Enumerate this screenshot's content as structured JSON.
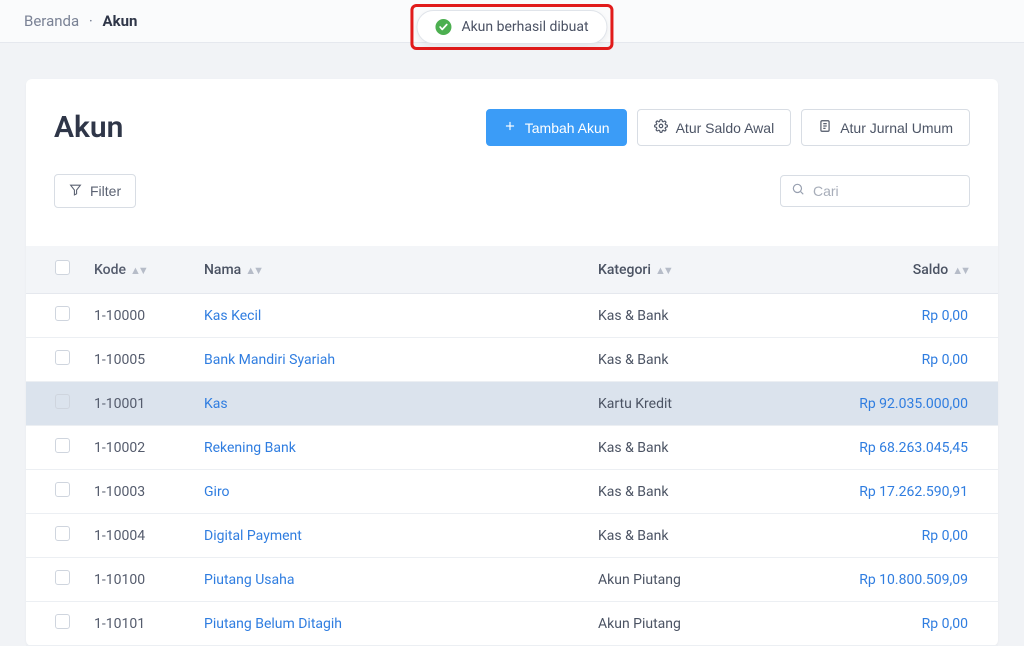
{
  "breadcrumb": {
    "home": "Beranda",
    "sep": "·",
    "current": "Akun"
  },
  "toast": {
    "text": "Akun berhasil dibuat"
  },
  "page": {
    "title": "Akun"
  },
  "buttons": {
    "add": "Tambah Akun",
    "opening": "Atur Saldo Awal",
    "journal": "Atur Jurnal Umum",
    "filter": "Filter"
  },
  "search": {
    "placeholder": "Cari"
  },
  "table": {
    "headers": {
      "kode": "Kode",
      "nama": "Nama",
      "kategori": "Kategori",
      "saldo": "Saldo"
    },
    "rows": [
      {
        "kode": "1-10000",
        "nama": "Kas Kecil",
        "kategori": "Kas & Bank",
        "saldo": "Rp 0,00",
        "highlight": false
      },
      {
        "kode": "1-10005",
        "nama": "Bank Mandiri Syariah",
        "kategori": "Kas & Bank",
        "saldo": "Rp 0,00",
        "highlight": false
      },
      {
        "kode": "1-10001",
        "nama": "Kas",
        "kategori": "Kartu Kredit",
        "saldo": "Rp 92.035.000,00",
        "highlight": true
      },
      {
        "kode": "1-10002",
        "nama": "Rekening Bank",
        "kategori": "Kas & Bank",
        "saldo": "Rp 68.263.045,45",
        "highlight": false
      },
      {
        "kode": "1-10003",
        "nama": "Giro",
        "kategori": "Kas & Bank",
        "saldo": "Rp 17.262.590,91",
        "highlight": false
      },
      {
        "kode": "1-10004",
        "nama": "Digital Payment",
        "kategori": "Kas & Bank",
        "saldo": "Rp 0,00",
        "highlight": false
      },
      {
        "kode": "1-10100",
        "nama": "Piutang Usaha",
        "kategori": "Akun Piutang",
        "saldo": "Rp 10.800.509,09",
        "highlight": false
      },
      {
        "kode": "1-10101",
        "nama": "Piutang Belum Ditagih",
        "kategori": "Akun Piutang",
        "saldo": "Rp 0,00",
        "highlight": false
      }
    ]
  }
}
